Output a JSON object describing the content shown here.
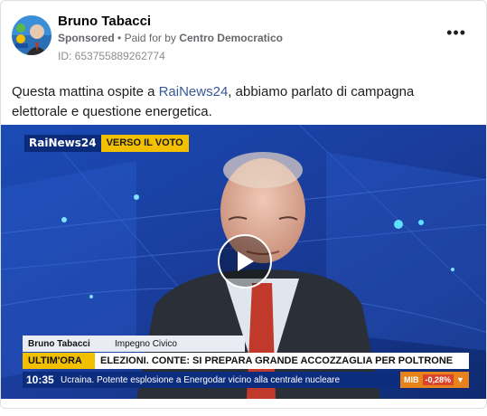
{
  "post": {
    "author": "Bruno Tabacci",
    "sponsored": "Sponsored",
    "paid_prefix": "Paid for by",
    "payer": "Centro Democratico",
    "ad_id": "ID: 653755889262774",
    "more_icon": "more-horizontal-icon",
    "text_before": "Questa mattina ospite a ",
    "text_link": "RaiNews24",
    "text_after": ", abbiamo parlato di campagna elettorale e questione energetica."
  },
  "video": {
    "channel_logo": "RaiNews24",
    "program_tag": "VERSO IL VOTO",
    "guest_name": "Bruno Tabacci",
    "guest_party": "Impegno Civico",
    "breaking_tag": "ULTIM'ORA",
    "headline": "ELEZIONI. CONTE: SI PREPARA GRANDE ACCOZZAGLIA PER POLTRONE",
    "clock": "10:35",
    "ticker": "Ucraina. Potente esplosione a Energodar vicino alla centrale nucleare",
    "market_label": "MIB",
    "market_value": "-0,28%",
    "market_arrow": "▼",
    "play_icon": "play-icon"
  },
  "colors": {
    "link": "#385898",
    "rai_blue": "#0b2a7a",
    "tag_yellow": "#f3c000",
    "market_orange": "#e8821a"
  }
}
